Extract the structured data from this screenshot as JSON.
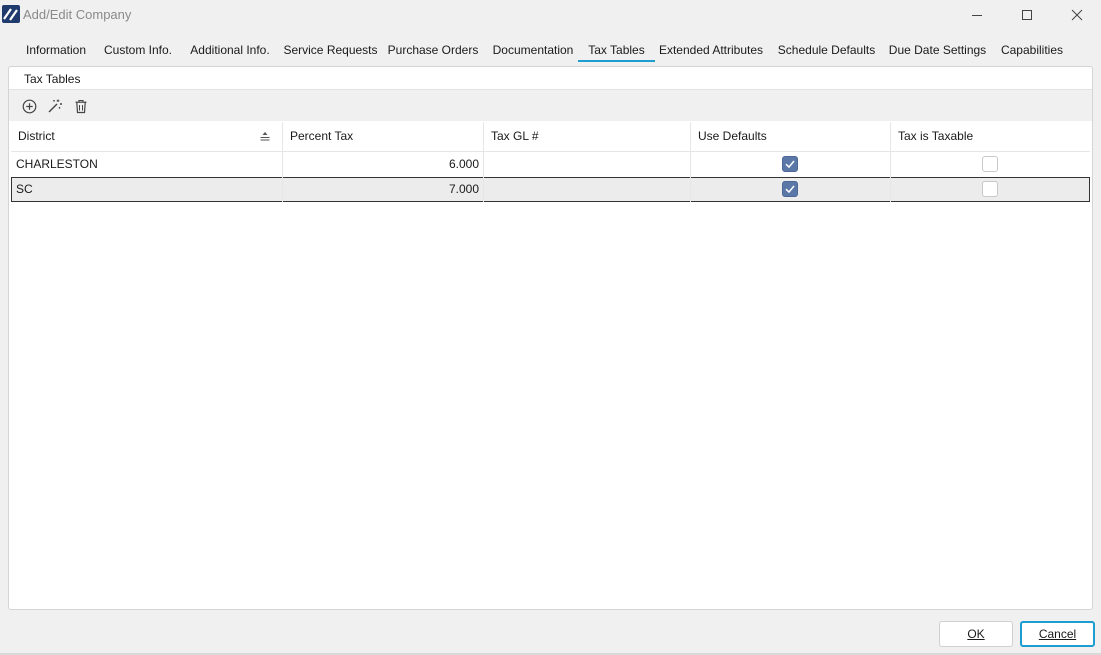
{
  "window": {
    "title": "Add/Edit Company"
  },
  "tabs": [
    {
      "label": "Information"
    },
    {
      "label": "Custom Info."
    },
    {
      "label": "Additional Info."
    },
    {
      "label": "Service Requests"
    },
    {
      "label": "Purchase Orders"
    },
    {
      "label": "Documentation"
    },
    {
      "label": "Tax Tables",
      "active": true
    },
    {
      "label": "Extended Attributes"
    },
    {
      "label": "Schedule Defaults"
    },
    {
      "label": "Due Date Settings"
    },
    {
      "label": "Capabilities"
    }
  ],
  "panel": {
    "title": "Tax Tables"
  },
  "toolbar": {
    "icons": [
      "add-circle-icon",
      "magic-wand-icon",
      "trash-icon"
    ]
  },
  "grid": {
    "columns": [
      "District",
      "Percent Tax",
      "Tax GL #",
      "Use Defaults",
      "Tax is Taxable"
    ],
    "sorted_column": "District",
    "rows": [
      {
        "district": "CHARLESTON",
        "percent_tax": "6.000",
        "tax_gl": "",
        "use_defaults": true,
        "tax_is_taxable": false
      },
      {
        "district": "SC",
        "percent_tax": "7.000",
        "tax_gl": "",
        "use_defaults": true,
        "tax_is_taxable": false,
        "selected": true
      }
    ]
  },
  "buttons": {
    "ok": "OK",
    "cancel": "Cancel"
  },
  "colors": {
    "accent": "#1e9dd0",
    "checkbox_checked": "#5a77a7",
    "app_icon": "#1f3b6e"
  }
}
